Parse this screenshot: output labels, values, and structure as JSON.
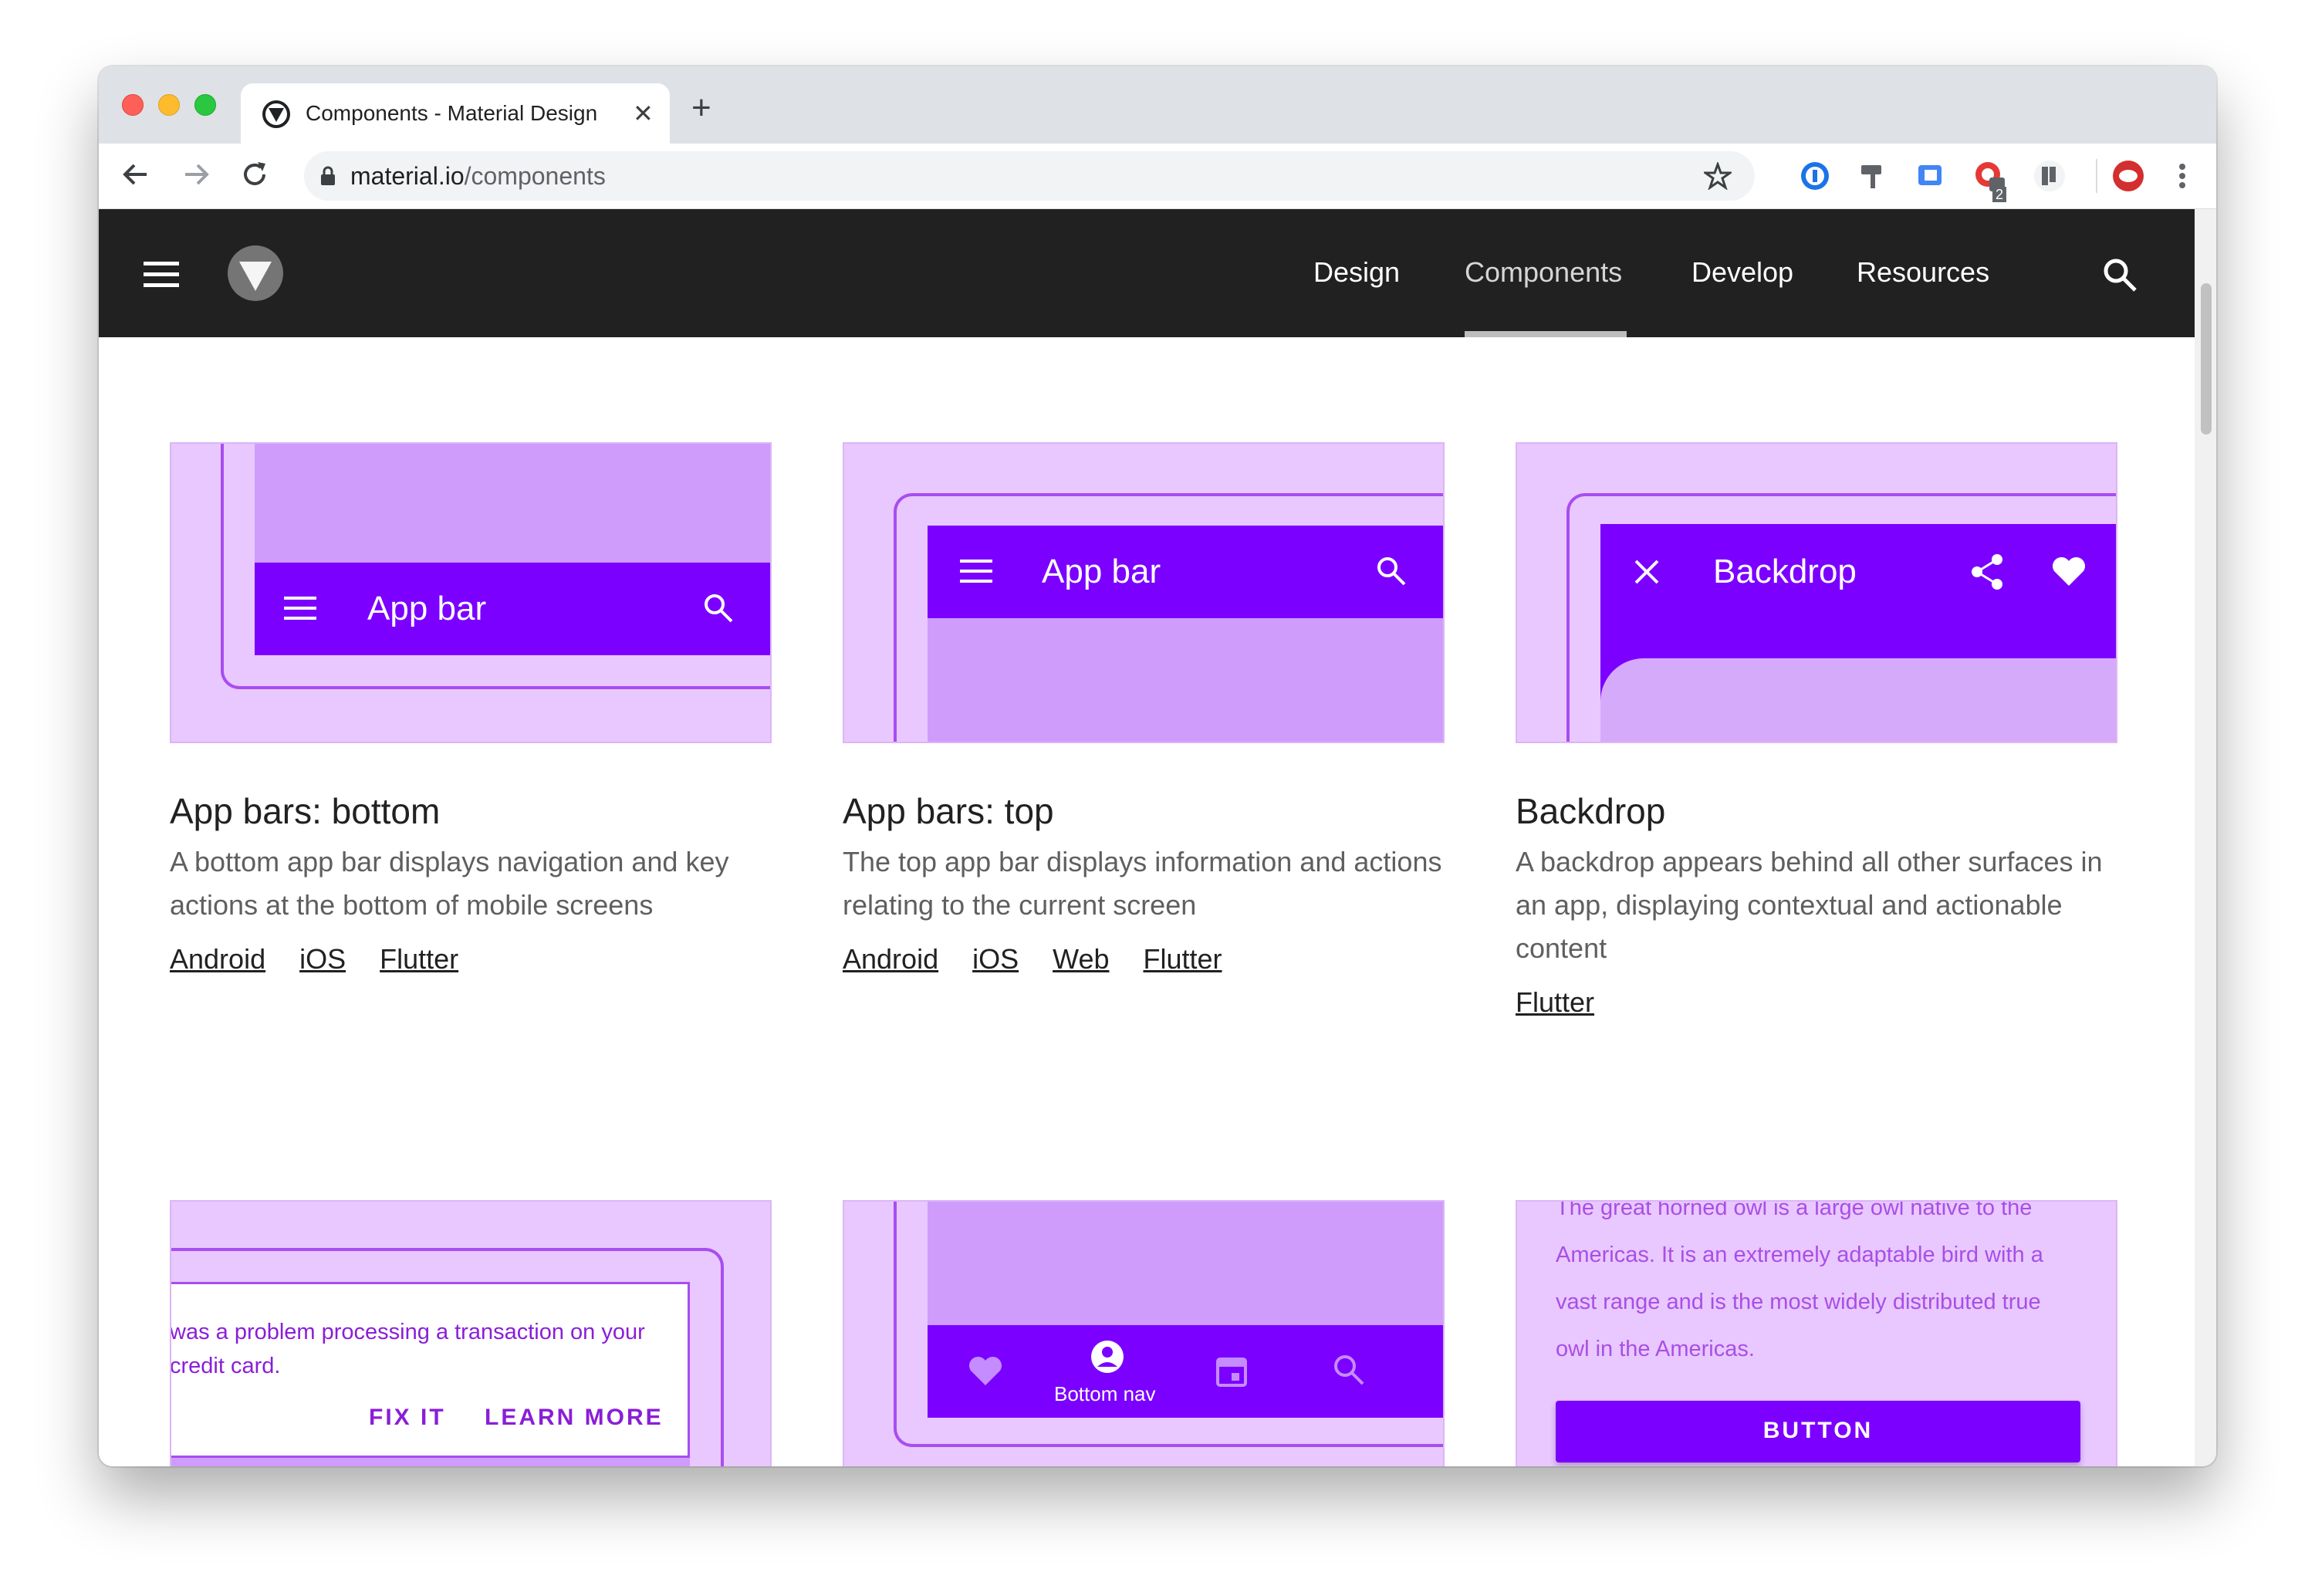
{
  "browser": {
    "tab_title": "Components - Material Design",
    "url_host": "material.io",
    "url_path": "/components",
    "extension_badge": "2"
  },
  "site": {
    "nav": [
      "Design",
      "Components",
      "Develop",
      "Resources"
    ],
    "active_nav": "Components"
  },
  "cards": [
    {
      "title": "App bars: bottom",
      "description": "A bottom app bar displays navigation and key actions at the bottom of mobile screens",
      "links": [
        "Android",
        "iOS",
        "Flutter"
      ],
      "image_label": "App bar"
    },
    {
      "title": "App bars: top",
      "description": "The top app bar displays information and actions relating to the current screen",
      "links": [
        "Android",
        "iOS",
        "Web",
        "Flutter"
      ],
      "image_label": "App bar"
    },
    {
      "title": "Backdrop",
      "description": "A backdrop appears behind all other surfaces in an app, displaying contextual and actionable content",
      "links": [
        "Flutter"
      ],
      "image_label": "Backdrop"
    }
  ],
  "previews": {
    "banner_text": "was a problem processing a transaction on your credit card.",
    "banner_actions": [
      "FIX IT",
      "LEARN MORE"
    ],
    "bottom_nav_label": "Bottom nav",
    "owl_text": "The great horned owl is a large owl native to the Americas. It is an extremely adaptable bird with a vast range and is the most widely distributed true owl in the Americas.",
    "button_label": "BUTTON"
  },
  "colors": {
    "accent": "#7b00ff",
    "card_bg": "#e8c8ff",
    "appbar": "#212121"
  }
}
